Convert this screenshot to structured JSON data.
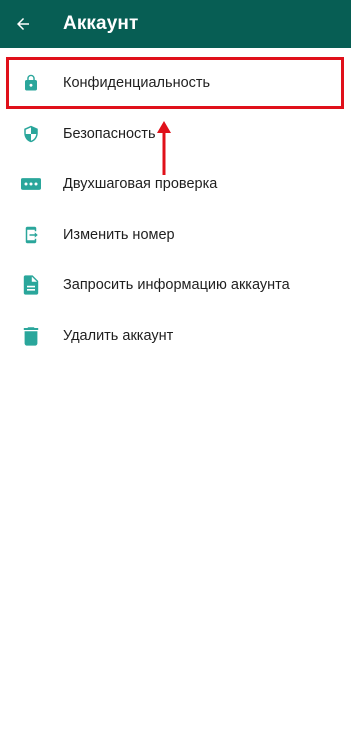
{
  "appbar": {
    "title": "Аккаунт",
    "back_icon": "arrow-left-icon",
    "background": "#075e54"
  },
  "menu": {
    "items": [
      {
        "id": "privacy",
        "label": "Конфиденциальность",
        "icon": "lock-icon"
      },
      {
        "id": "security",
        "label": "Безопасность",
        "icon": "shield-icon"
      },
      {
        "id": "two-step",
        "label": "Двухшаговая проверка",
        "icon": "dots-password-icon"
      },
      {
        "id": "change-number",
        "label": "Изменить номер",
        "icon": "phone-transfer-icon"
      },
      {
        "id": "request-info",
        "label": "Запросить информацию аккаунта",
        "icon": "document-icon"
      },
      {
        "id": "delete",
        "label": "Удалить аккаунт",
        "icon": "trash-icon"
      }
    ],
    "icon_color": "#2aa69b"
  },
  "annotation": {
    "highlight_color": "#e0101a",
    "highlighted_item": "privacy"
  }
}
